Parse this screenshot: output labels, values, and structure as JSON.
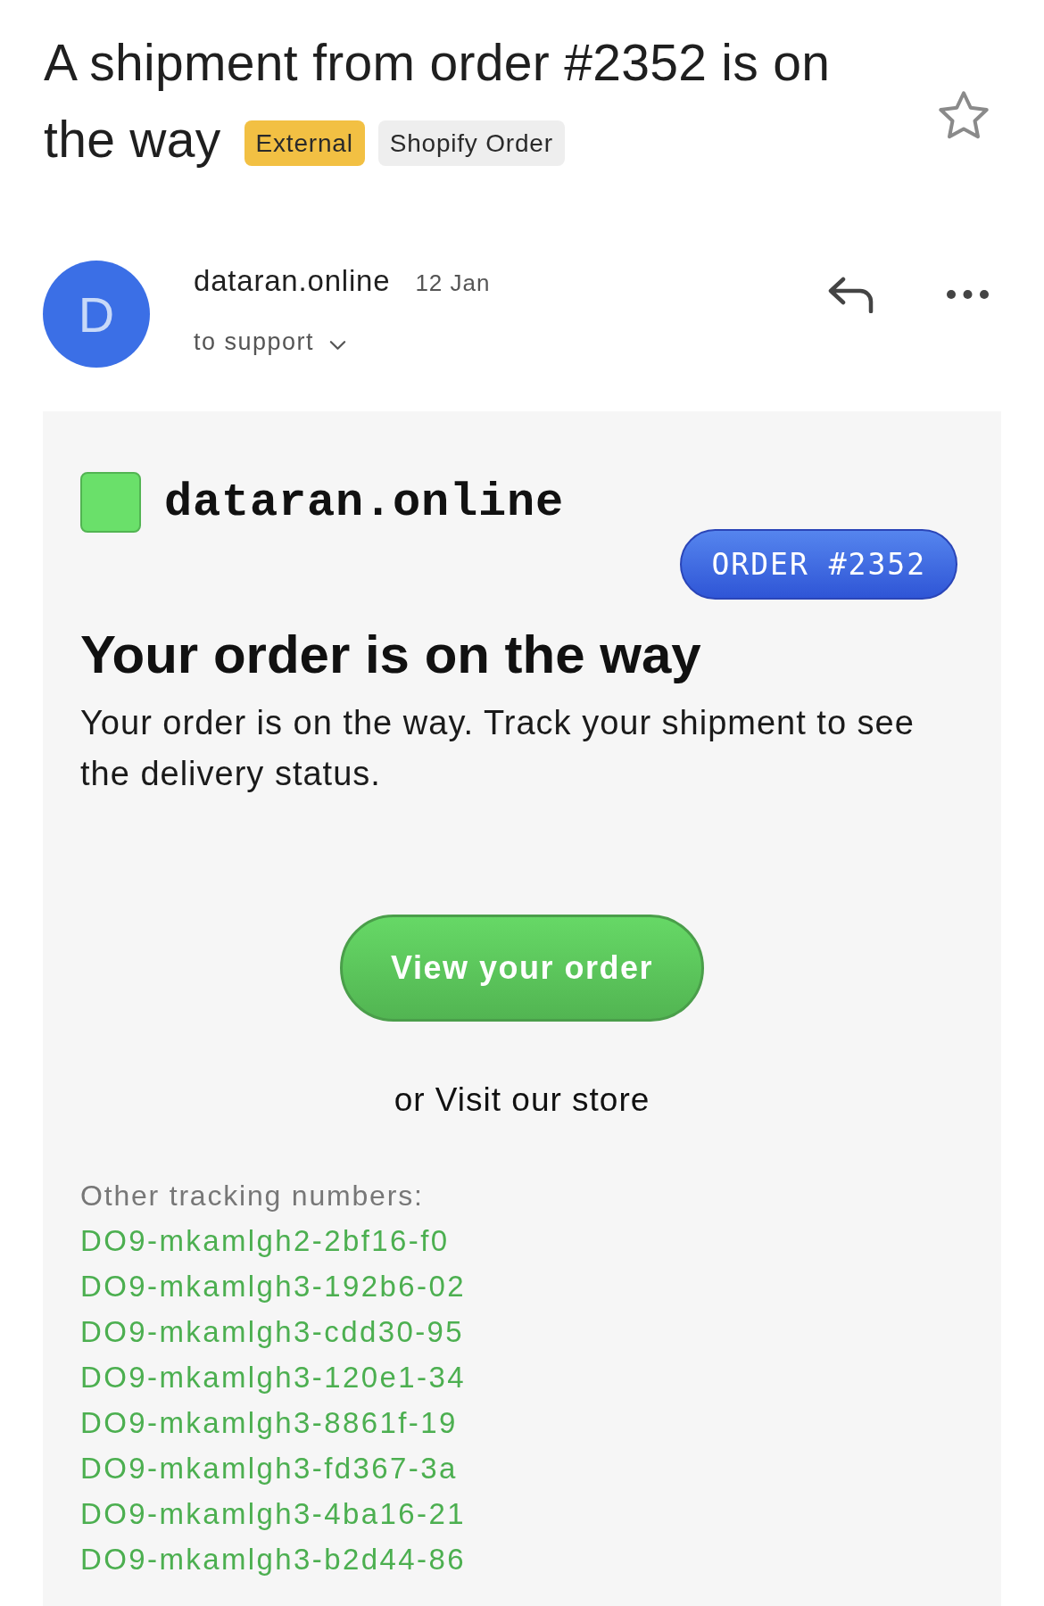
{
  "email": {
    "subject_lines": [
      "A shipment from order #2352 is on",
      "the way"
    ],
    "labels": [
      {
        "text": "External",
        "color": "#f2c043"
      },
      {
        "text": "Shopify Order",
        "color": "#eeeeee"
      }
    ],
    "starred": false
  },
  "sender": {
    "avatar_letter": "D",
    "name": "dataran.online",
    "date": "12 Jan",
    "recipient": "to support"
  },
  "message": {
    "store_name": "dataran.online",
    "order_tag": "ORDER #2352",
    "heading": "Your order is on the way",
    "text": "Your order is on the way. Track your shipment to see the delivery status.",
    "button": "View your order",
    "store_link": "or Visit our store",
    "tracking_label": "Other tracking numbers:",
    "tracking_numbers": [
      "DO9-mkamlgh2-2bf16-f0",
      "DO9-mkamlgh3-192b6-02",
      "DO9-mkamlgh3-cdd30-95",
      "DO9-mkamlgh3-120e1-34",
      "DO9-mkamlgh3-8861f-19",
      "DO9-mkamlgh3-fd367-3a",
      "DO9-mkamlgh3-4ba16-21",
      "DO9-mkamlgh3-b2d44-86"
    ]
  }
}
